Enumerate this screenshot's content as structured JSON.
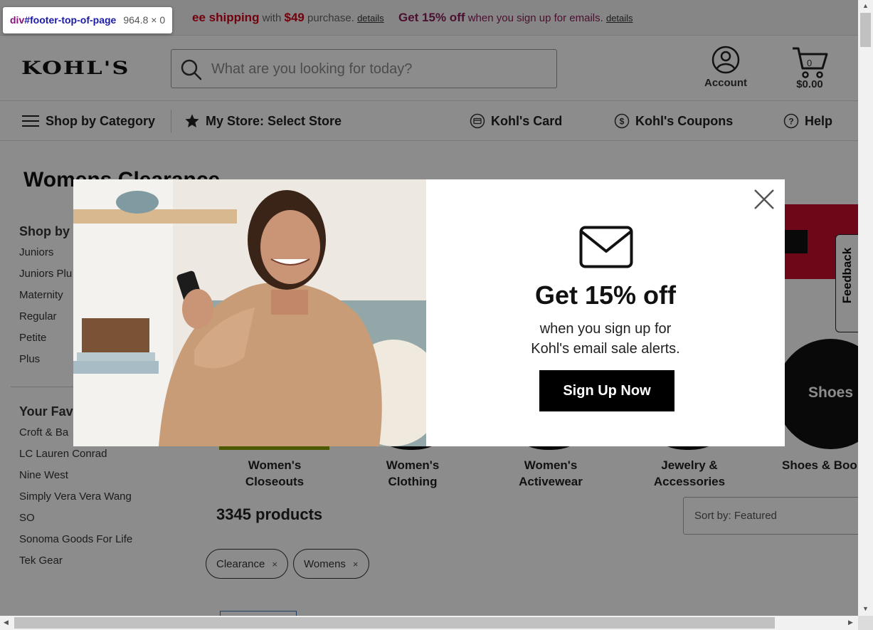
{
  "tooltip": {
    "tag": "div",
    "id": "#footer-top-of-page",
    "dims": "964.8 × 0"
  },
  "promo": {
    "part1_strong": "ee shipping",
    "part1_rest": " with ",
    "part1_amount": "$49",
    "part1_tail": " purchase. ",
    "details1": "details",
    "part2_strong": "Get 15% off",
    "part2_rest": " when you sign up for emails. ",
    "details2": "details"
  },
  "header": {
    "logo": "KOHL'S",
    "search_placeholder": "What are you looking for today?",
    "account_label": "Account",
    "cart_count": "0",
    "cart_total": "$0.00"
  },
  "nav": {
    "shop_by_category": "Shop by Category",
    "my_store": "My Store: Select Store",
    "kohls_card": "Kohl's Card",
    "kohls_coupons": "Kohl's Coupons",
    "help": "Help"
  },
  "page_title": "Womens Clearance",
  "sidebar": {
    "shop_by_heading": "Shop by",
    "shop_by_items": [
      "Juniors",
      "Juniors Plu",
      "Maternity",
      "Regular",
      "Petite",
      "Plus"
    ],
    "favorites_heading": "Your Fav",
    "favorite_items": [
      "Croft & Ba",
      "LC Lauren Conrad",
      "Nine West",
      "Simply Vera Vera Wang",
      "SO",
      "Sonoma Goods For Life",
      "Tek Gear"
    ]
  },
  "feedback_label": "Feedback",
  "categories": [
    {
      "label_line1": "Women's",
      "label_line2": "Closeouts"
    },
    {
      "label_line1": "Women's",
      "label_line2": "Clothing"
    },
    {
      "label_line1": "Women's",
      "label_line2": "Activewear"
    },
    {
      "label_line1": "Jewelry &",
      "label_line2": "Accessories"
    },
    {
      "label_line1": "Shoes & Boo",
      "label_line2": ""
    }
  ],
  "shoes_circle_label": "Shoes",
  "products_count": "3345 products",
  "sort_label": "Sort by: Featured",
  "chips": [
    {
      "label": "Clearance",
      "x": "×"
    },
    {
      "label": "Womens",
      "x": "×"
    }
  ],
  "modal": {
    "heading": "Get 15% off",
    "body_line1": "when you sign up for",
    "body_line2": "Kohl's email sale alerts.",
    "button": "Sign Up Now"
  },
  "colors": {
    "promo_red": "#d0021b",
    "promo_purple": "#8a1d5a",
    "banner_red": "#c8102e",
    "button_black": "#000000",
    "underline_green": "#8fa000"
  }
}
